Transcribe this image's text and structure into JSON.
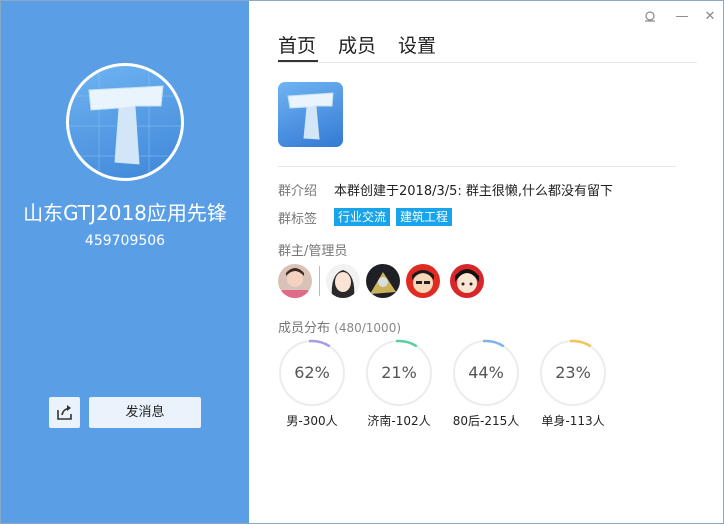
{
  "group": {
    "name": "山东GTJ2018应用先锋",
    "id": "459709506",
    "logo_letter": "T",
    "send_message_label": "发消息",
    "share_icon": "share-icon"
  },
  "window_controls": {
    "pin_icon": "pin-icon",
    "minimize_label": "—",
    "close_label": "✕"
  },
  "tabs": [
    {
      "label": "首页",
      "active": true
    },
    {
      "label": "成员",
      "active": false
    },
    {
      "label": "设置",
      "active": false
    }
  ],
  "intro": {
    "label": "群介绍",
    "text": "本群创建于2018/3/5:  群主很懒,什么都没有留下"
  },
  "tags": {
    "label": "群标签",
    "items": [
      "行业交流",
      "建筑工程"
    ]
  },
  "admins": {
    "label": "群主/管理员",
    "avatars": [
      "owner-avatar",
      "admin-avatar-1",
      "admin-avatar-2",
      "admin-avatar-3",
      "admin-avatar-4"
    ]
  },
  "distribution": {
    "label": "成员分布",
    "count": "(480/1000)",
    "stats": [
      {
        "percent": "62%",
        "value": 0.62,
        "caption": "男-300人",
        "color": "#a99be6"
      },
      {
        "percent": "21%",
        "value": 0.21,
        "caption": "济南-102人",
        "color": "#56d19b"
      },
      {
        "percent": "44%",
        "value": 0.44,
        "caption": "80后-215人",
        "color": "#7ab3ee"
      },
      {
        "percent": "23%",
        "value": 0.23,
        "caption": "单身-113人",
        "color": "#f5c258"
      }
    ]
  }
}
